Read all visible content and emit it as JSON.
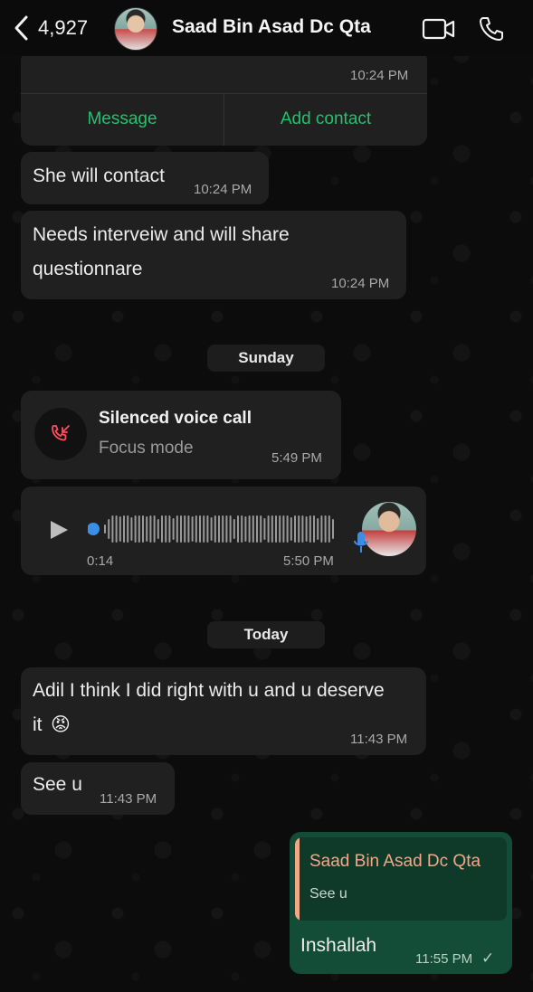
{
  "header": {
    "back_count": "4,927",
    "contact_name": "Saad Bin Asad Dc Qta"
  },
  "messages": {
    "contact_card": {
      "time": "10:24 PM",
      "message_btn": "Message",
      "add_contact_btn": "Add contact"
    },
    "m1": {
      "text": "She will contact",
      "time": "10:24 PM"
    },
    "m2": {
      "line1": "Needs interveiw and will share",
      "line2": "questionnare",
      "time": "10:24 PM"
    },
    "day1": "Sunday",
    "call": {
      "title": "Silenced voice call",
      "subtitle": "Focus mode",
      "time": "5:49 PM"
    },
    "voice": {
      "duration": "0:14",
      "time": "5:50 PM"
    },
    "day2": "Today",
    "m3": {
      "line1": "Adil I think I did right with u and u deserve",
      "line2": "it",
      "emoji": "😡",
      "time": "11:43 PM"
    },
    "m4": {
      "text": "See u",
      "time": "11:43 PM"
    },
    "out1": {
      "reply_name": "Saad Bin Asad Dc Qta",
      "reply_text": "See u",
      "text": "Inshallah",
      "time": "11:55 PM",
      "status": "✓"
    }
  },
  "colors": {
    "accent_green": "#25c16f",
    "outgoing_bubble": "#134d37",
    "incoming_bubble": "#202020",
    "quote_name": "#f0a889"
  }
}
